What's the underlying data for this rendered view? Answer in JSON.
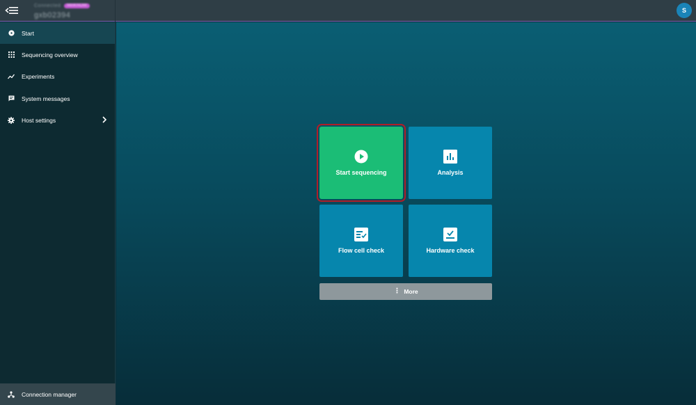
{
  "header": {
    "host_small": "Connected",
    "host_badge": "MinKNOW",
    "host_name": "gxb02394",
    "avatar_letter": "S"
  },
  "sidebar": {
    "items": [
      {
        "label": "Start",
        "icon": "play-circle-icon",
        "active": true
      },
      {
        "label": "Sequencing overview",
        "icon": "grid-icon"
      },
      {
        "label": "Experiments",
        "icon": "trend-line-icon"
      },
      {
        "label": "System messages",
        "icon": "message-icon"
      },
      {
        "label": "Host settings",
        "icon": "gear-icon",
        "has_submenu": true
      }
    ],
    "footer": {
      "label": "Connection manager",
      "icon": "network-icon"
    }
  },
  "main": {
    "tiles": [
      {
        "label": "Start sequencing",
        "icon": "play-circle-icon",
        "color": "#1bbd76",
        "highlighted": true
      },
      {
        "label": "Analysis",
        "icon": "bar-chart-icon",
        "color": "#0686ad"
      },
      {
        "label": "Flow cell check",
        "icon": "flow-cell-check-icon",
        "color": "#0686ad"
      },
      {
        "label": "Hardware check",
        "icon": "hardware-check-icon",
        "color": "#0686ad"
      }
    ],
    "more_label": "More"
  },
  "colors": {
    "accent_green": "#1bbd76",
    "tile_blue": "#0686ad",
    "highlight_red": "#b01e28",
    "topbar_border": "#7b5fb3"
  }
}
